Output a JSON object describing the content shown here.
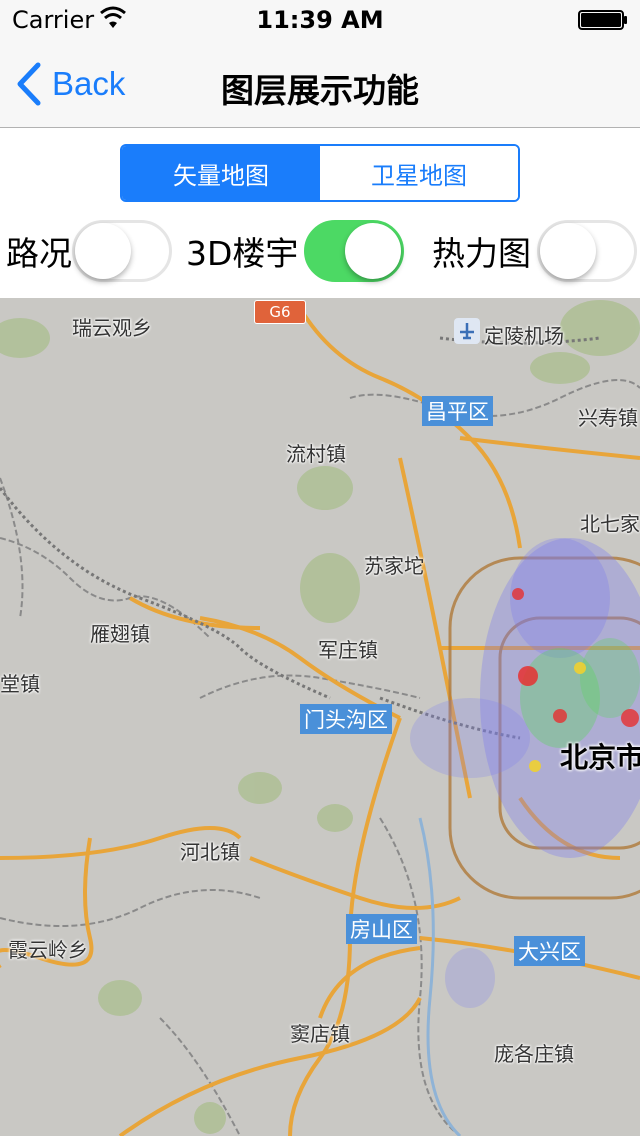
{
  "status_bar": {
    "carrier": "Carrier",
    "time": "11:39 AM"
  },
  "nav": {
    "back_label": "Back",
    "title": "图层展示功能"
  },
  "segment": {
    "options": [
      "矢量地图",
      "卫星地图"
    ],
    "selected": "矢量地图"
  },
  "toggles": [
    {
      "label": "路况",
      "state": "off"
    },
    {
      "label": "3D楼宇",
      "state": "on"
    },
    {
      "label": "热力图",
      "state": "off"
    }
  ],
  "map": {
    "highway_shield": "G6",
    "places": [
      "瑞云观乡",
      "定陵机场",
      "兴寿镇",
      "流村镇",
      "北七家",
      "苏家坨",
      "雁翅镇",
      "军庄镇",
      "堂镇",
      "河北镇",
      "霞云岭乡",
      "窦店镇",
      "庞各庄镇"
    ],
    "districts": [
      "昌平区",
      "门头沟区",
      "房山区",
      "大兴区"
    ],
    "city": "北京市",
    "colors": {
      "land": "#c9c8c4",
      "green": "#aebf95",
      "highway": "#e8a53a",
      "heat_low": "#7b7bf0",
      "heat_high": "#e63030"
    }
  }
}
